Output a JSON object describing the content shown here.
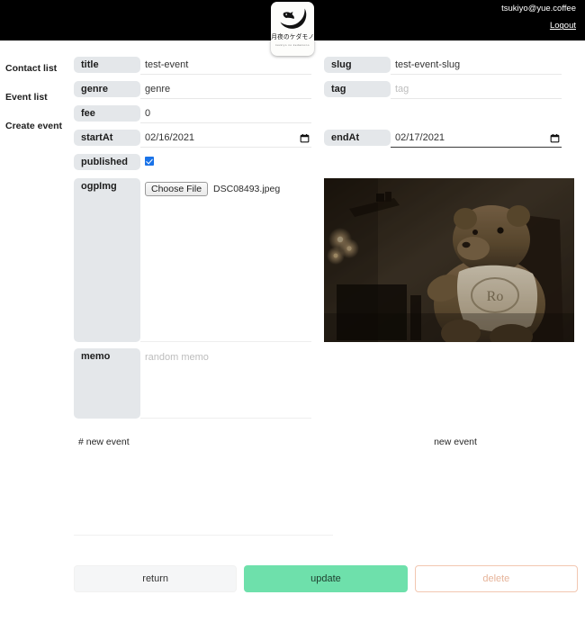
{
  "header": {
    "user_email": "tsukiyo@yue.coffee",
    "logout_label": "Logout",
    "logo_jp": "月夜のケダモノ",
    "logo_sub": "tsukiyo no kedamono"
  },
  "sidebar": {
    "items": [
      {
        "label": "Contact list"
      },
      {
        "label": "Event list"
      },
      {
        "label": "Create event"
      }
    ]
  },
  "form": {
    "title": {
      "label": "title",
      "value": "test-event"
    },
    "slug": {
      "label": "slug",
      "value": "test-event-slug"
    },
    "genre": {
      "label": "genre",
      "value": "genre"
    },
    "tag": {
      "label": "tag",
      "value": "",
      "placeholder": "tag"
    },
    "fee": {
      "label": "fee",
      "value": "0"
    },
    "startAt": {
      "label": "startAt",
      "value": "02/16/2021"
    },
    "endAt": {
      "label": "endAt",
      "value": "02/17/2021"
    },
    "published": {
      "label": "published",
      "checked": true
    },
    "ogpImg": {
      "label": "ogpImg",
      "choose_label": "Choose File",
      "file_name": "DSC08493.jpeg"
    },
    "memo": {
      "label": "memo",
      "value": "",
      "placeholder": "random memo"
    }
  },
  "markdown": {
    "source": "# new event",
    "preview": "new event"
  },
  "actions": {
    "return_label": "return",
    "update_label": "update",
    "delete_label": "delete"
  },
  "colors": {
    "header_bg": "#000000",
    "label_pill": "#e4e7ea",
    "update_green": "#6ee0ab",
    "delete_orange": "#e6b49a",
    "delete_border": "#f2c7b1",
    "checkbox_blue": "#1a73e8"
  }
}
